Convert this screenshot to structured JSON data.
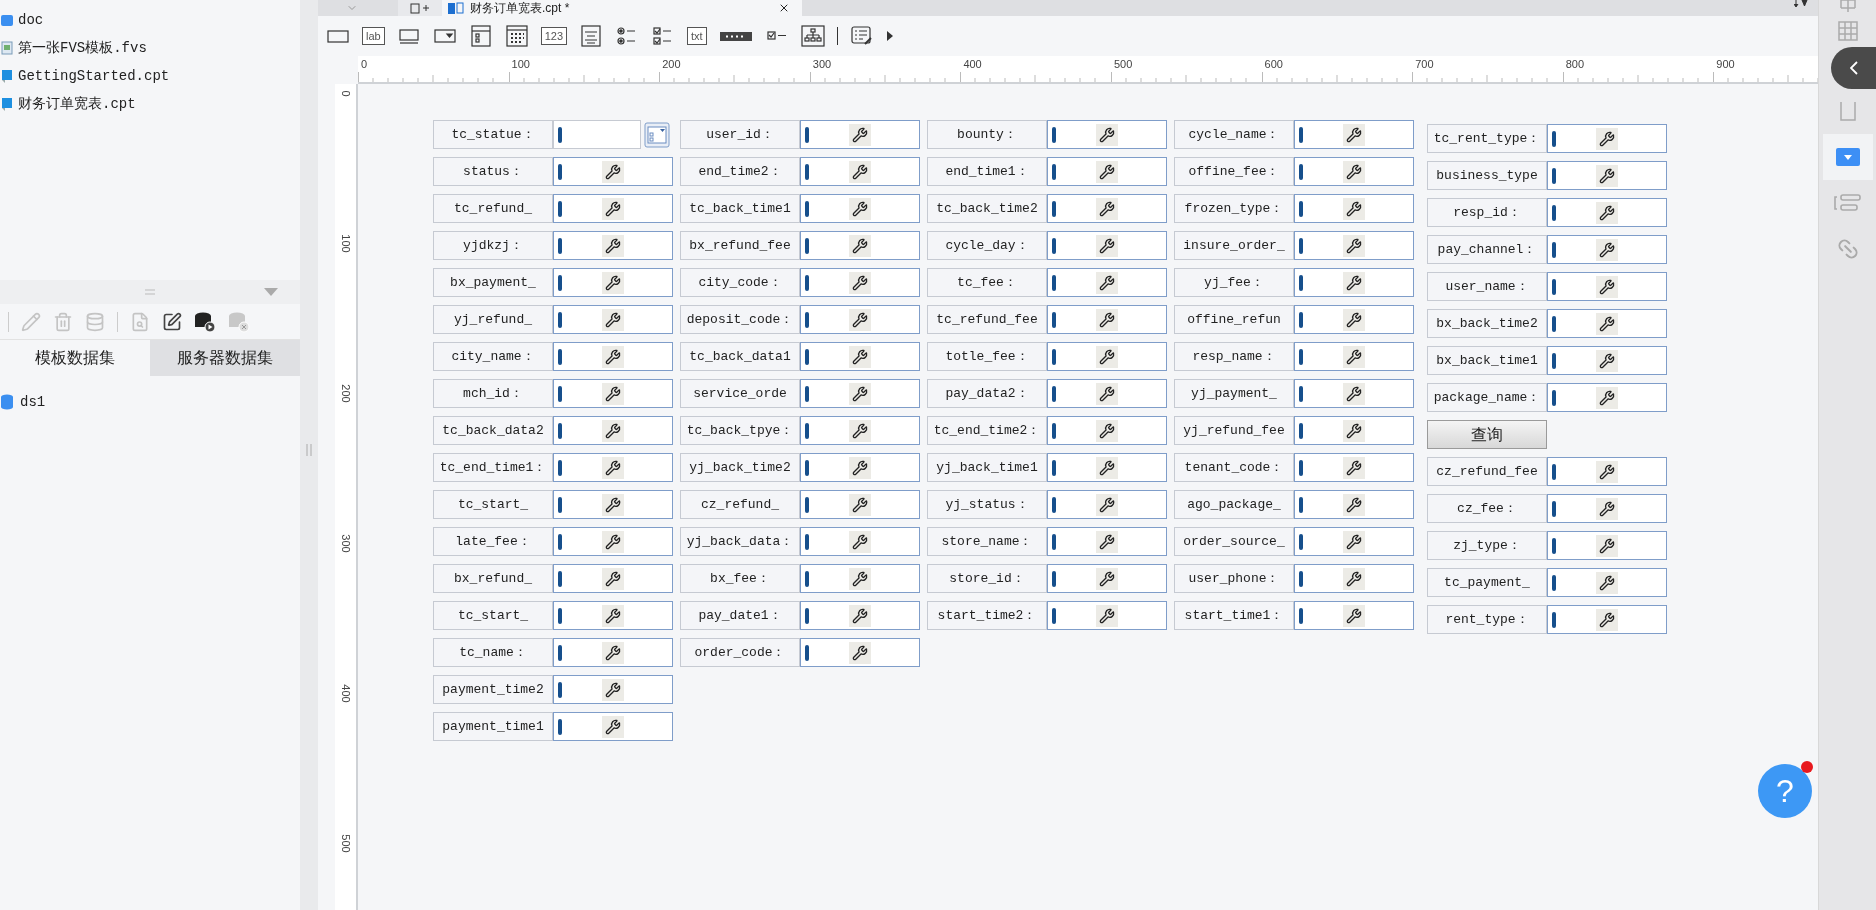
{
  "editor_tab": {
    "title": "财务订单宽表.cpt *"
  },
  "file_tree": [
    {
      "kind": "folder",
      "name": "doc"
    },
    {
      "kind": "fvs",
      "name": "第一张FVS模板.fvs"
    },
    {
      "kind": "cpt",
      "name": "GettingStarted.cpt"
    },
    {
      "kind": "cpt",
      "name": "财务订单宽表.cpt"
    }
  ],
  "dataset_tabs": [
    {
      "label": "模板数据集",
      "selected": true
    },
    {
      "label": "服务器数据集",
      "selected": false
    }
  ],
  "datasets": [
    "ds1"
  ],
  "widget_toolbar": [
    {
      "kind": "frame"
    },
    {
      "kind": "text",
      "text": "lab"
    },
    {
      "kind": "button"
    },
    {
      "kind": "combo"
    },
    {
      "kind": "list"
    },
    {
      "kind": "calendar"
    },
    {
      "kind": "text",
      "text": "123"
    },
    {
      "kind": "textarea"
    },
    {
      "kind": "radio"
    },
    {
      "kind": "checkgroup"
    },
    {
      "kind": "text",
      "text": "txt"
    },
    {
      "kind": "password"
    },
    {
      "kind": "checkbox"
    },
    {
      "kind": "tree"
    },
    {
      "kind": "divider"
    },
    {
      "kind": "report"
    },
    {
      "kind": "more"
    }
  ],
  "ruler": {
    "x_labels": [
      "0",
      "100",
      "200",
      "300",
      "400",
      "500",
      "600",
      "700",
      "800",
      "900"
    ],
    "y_labels": [
      "0",
      "100",
      "200",
      "300",
      "400",
      "500"
    ]
  },
  "form_columns": [
    [
      {
        "kind": "combo",
        "label": "tc_statue："
      },
      {
        "kind": "text",
        "label": "status："
      },
      {
        "kind": "text",
        "label": "tc_refund_"
      },
      {
        "kind": "text",
        "label": "yjdkzj："
      },
      {
        "kind": "text",
        "label": "bx_payment_"
      },
      {
        "kind": "text",
        "label": "yj_refund_"
      },
      {
        "kind": "text",
        "label": "city_name："
      },
      {
        "kind": "text",
        "label": "mch_id："
      },
      {
        "kind": "text",
        "label": "tc_back_data2"
      },
      {
        "kind": "text",
        "label": "tc_end_time1："
      },
      {
        "kind": "text",
        "label": "tc_start_"
      },
      {
        "kind": "text",
        "label": "late_fee："
      },
      {
        "kind": "text",
        "label": "bx_refund_"
      },
      {
        "kind": "text",
        "label": "tc_start_"
      },
      {
        "kind": "text",
        "label": "tc_name："
      },
      {
        "kind": "text",
        "label": "payment_time2"
      },
      {
        "kind": "text",
        "label": "payment_time1"
      }
    ],
    [
      {
        "kind": "text",
        "label": "user_id："
      },
      {
        "kind": "text",
        "label": "end_time2："
      },
      {
        "kind": "text",
        "label": "tc_back_time1"
      },
      {
        "kind": "text",
        "label": "bx_refund_fee"
      },
      {
        "kind": "text",
        "label": "city_code："
      },
      {
        "kind": "text",
        "label": "deposit_code："
      },
      {
        "kind": "text",
        "label": "tc_back_data1"
      },
      {
        "kind": "text",
        "label": "service_orde"
      },
      {
        "kind": "text",
        "label": "tc_back_tpye："
      },
      {
        "kind": "text",
        "label": "yj_back_time2"
      },
      {
        "kind": "text",
        "label": "cz_refund_"
      },
      {
        "kind": "text",
        "label": "yj_back_data："
      },
      {
        "kind": "text",
        "label": "bx_fee："
      },
      {
        "kind": "text",
        "label": "pay_date1："
      },
      {
        "kind": "text",
        "label": "order_code："
      }
    ],
    [
      {
        "kind": "text",
        "label": "bounty："
      },
      {
        "kind": "text",
        "label": "end_time1："
      },
      {
        "kind": "text",
        "label": "tc_back_time2"
      },
      {
        "kind": "text",
        "label": "cycle_day："
      },
      {
        "kind": "text",
        "label": "tc_fee："
      },
      {
        "kind": "text",
        "label": "tc_refund_fee"
      },
      {
        "kind": "text",
        "label": "totle_fee："
      },
      {
        "kind": "text",
        "label": "pay_data2："
      },
      {
        "kind": "text",
        "label": "tc_end_time2："
      },
      {
        "kind": "text",
        "label": "yj_back_time1"
      },
      {
        "kind": "text",
        "label": "yj_status："
      },
      {
        "kind": "text",
        "label": "store_name："
      },
      {
        "kind": "text",
        "label": "store_id："
      },
      {
        "kind": "text",
        "label": "start_time2："
      }
    ],
    [
      {
        "kind": "text",
        "label": "cycle_name："
      },
      {
        "kind": "text",
        "label": "offine_fee："
      },
      {
        "kind": "text",
        "label": "frozen_type："
      },
      {
        "kind": "text",
        "label": "insure_order_"
      },
      {
        "kind": "text",
        "label": "yj_fee："
      },
      {
        "kind": "text",
        "label": "offine_refun"
      },
      {
        "kind": "text",
        "label": "resp_name："
      },
      {
        "kind": "text",
        "label": "yj_payment_"
      },
      {
        "kind": "text",
        "label": "yj_refund_fee"
      },
      {
        "kind": "text",
        "label": "tenant_code："
      },
      {
        "kind": "text",
        "label": "ago_package_"
      },
      {
        "kind": "text",
        "label": "order_source_"
      },
      {
        "kind": "text",
        "label": "user_phone："
      },
      {
        "kind": "text",
        "label": "start_time1："
      }
    ],
    [
      {
        "kind": "text",
        "label": "tc_rent_type："
      },
      {
        "kind": "text",
        "label": "business_type"
      },
      {
        "kind": "text",
        "label": "resp_id："
      },
      {
        "kind": "text",
        "label": "pay_channel："
      },
      {
        "kind": "text",
        "label": "user_name："
      },
      {
        "kind": "text",
        "label": "bx_back_time2"
      },
      {
        "kind": "text",
        "label": "bx_back_time1"
      },
      {
        "kind": "text",
        "label": "package_name："
      },
      {
        "kind": "button",
        "label": "查询"
      },
      {
        "kind": "text",
        "label": "cz_refund_fee"
      },
      {
        "kind": "text",
        "label": "cz_fee："
      },
      {
        "kind": "text",
        "label": "zj_type："
      },
      {
        "kind": "text",
        "label": "tc_payment_"
      },
      {
        "kind": "text",
        "label": "rent_type："
      }
    ]
  ],
  "side_panel": [
    {
      "kind": "grid",
      "selected": false
    },
    {
      "kind": "table",
      "selected": false
    },
    {
      "kind": "frame",
      "selected": false
    },
    {
      "kind": "combo",
      "selected": true
    },
    {
      "kind": "list",
      "selected": false
    },
    {
      "kind": "link",
      "selected": false
    }
  ],
  "help_button": {
    "text": "?",
    "notification": true
  }
}
